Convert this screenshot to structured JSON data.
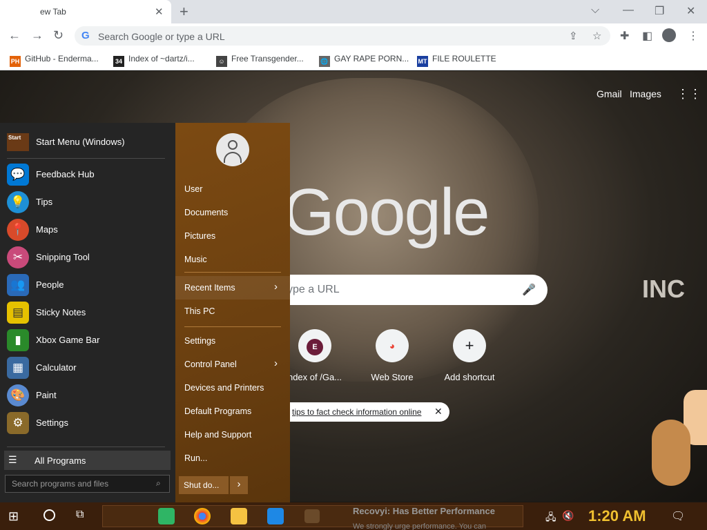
{
  "browser": {
    "tab_title": "ew Tab",
    "new_tab_symbol": "+",
    "window_controls": [
      "⌵",
      "—",
      "❐",
      "✕"
    ],
    "omnibox_placeholder": "Search Google or type a URL",
    "bookmarks": [
      {
        "label": "GitHub - Enderma...",
        "icon": "PH",
        "color": "#e36209"
      },
      {
        "label": "Index of ~dartz/i...",
        "icon": "34",
        "color": "#222"
      },
      {
        "label": "Free Transgender...",
        "icon": "☺",
        "color": "#333"
      },
      {
        "label": "GAY RAPE PORN...",
        "icon": "🌐",
        "color": "#555"
      },
      {
        "label": "FILE ROULETTE",
        "icon": "MT",
        "color": "#1a3fa0"
      }
    ]
  },
  "ntp": {
    "gmail": "Gmail",
    "images": "Images",
    "logo": "Google",
    "search_placeholder": "ype a URL",
    "shortcuts": [
      {
        "label": "ndex of /Ga...",
        "letter": "E",
        "color": "#6b1d3a"
      },
      {
        "label": "Web Store",
        "letter": "◕",
        "color": "#ea4335"
      },
      {
        "label": "Add shortcut",
        "letter": "+",
        "color": "#202124"
      }
    ],
    "notice": "tips to fact check information online",
    "sign": "INC"
  },
  "start_menu": {
    "pinned_label": "Start Menu (Windows)",
    "pinned_icon_text": "Start",
    "apps": [
      {
        "label": "Feedback Hub",
        "icon": "💬",
        "color": "#0078d4"
      },
      {
        "label": "Tips",
        "icon": "💡",
        "color": "#1e90d6"
      },
      {
        "label": "Maps",
        "icon": "📍",
        "color": "#d84a2a"
      },
      {
        "label": "Snipping Tool",
        "icon": "✂",
        "color": "#c94a7a"
      },
      {
        "label": "People",
        "icon": "👥",
        "color": "#2a6ab8"
      },
      {
        "label": "Sticky Notes",
        "icon": "▤",
        "color": "#e6c100"
      },
      {
        "label": "Xbox Game Bar",
        "icon": "▮",
        "color": "#2a8a2a"
      },
      {
        "label": "Calculator",
        "icon": "▦",
        "color": "#3a6aa0"
      },
      {
        "label": "Paint",
        "icon": "🎨",
        "color": "#5a8ad0"
      },
      {
        "label": "Settings",
        "icon": "⚙",
        "color": "#8a6a2a"
      }
    ],
    "all_programs": "All Programs",
    "search_placeholder": "Search programs and files",
    "user": "User",
    "places": {
      "documents": "Documents",
      "pictures": "Pictures",
      "music": "Music",
      "recent_items": "Recent Items",
      "this_pc": "This PC",
      "settings": "Settings",
      "control_panel": "Control Panel",
      "devices_printers": "Devices and Printers",
      "default_programs": "Default Programs",
      "help_support": "Help and Support",
      "run": "Run..."
    },
    "shutdown": "Shut do...",
    "arrow": "›"
  },
  "taskbar": {
    "overlay_title": "Recovyi: Has Better Performance",
    "overlay_sub": "We strongly urge performance. You can",
    "clock": "1:20 AM"
  }
}
